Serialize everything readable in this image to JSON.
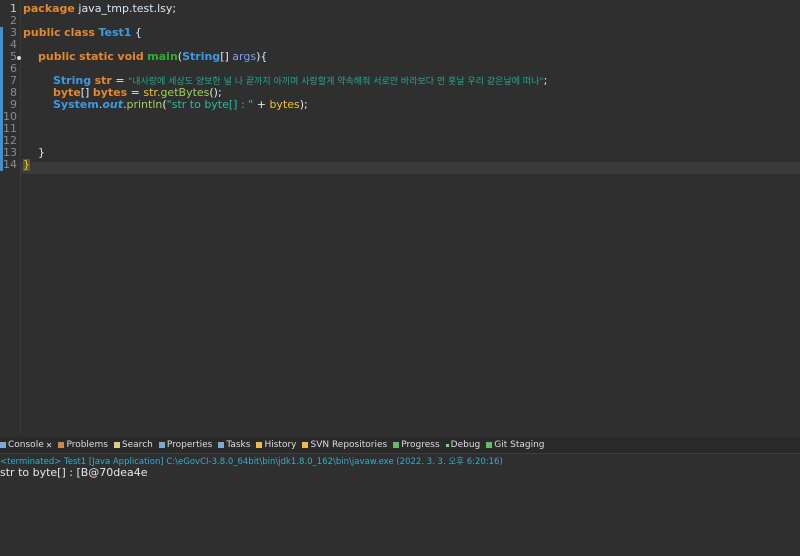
{
  "editor": {
    "lines": [
      "package java_tmp.test.lsy;",
      "",
      "public class Test1 {",
      "",
      "public static void main(String[] args){",
      "",
      "String str = \"내사랑에 세상도 양보한 널 나 끝까지 아끼며 사랑할게 약속해줘 서로만 바라보다 먼 훗날 우리 같은날에 떠나\";",
      "byte[] bytes = str.getBytes();",
      "System.out.println(\"str to byte[] : \" + bytes);",
      "",
      "",
      "",
      "}",
      "}"
    ],
    "line_numbers": [
      "1",
      "2",
      "3",
      "4",
      "5",
      "6",
      "7",
      "8",
      "9",
      "10",
      "11",
      "12",
      "13",
      "14"
    ],
    "tokens": {
      "package": "package",
      "pkg": " java_tmp.test.lsy;",
      "public": "public",
      "class": "class",
      "Test1": "Test1",
      "brace": " {",
      "static": "static",
      "void": "void",
      "main": "main",
      "String": "String",
      "args_pre": "[] ",
      "args": "args",
      "args_post": "){",
      "str": "str",
      "eq": " = ",
      "literal": "\"내사랑에 세상도 양보한 널 나 끝까지 아끼며 사랑할게 약속해줘 서로만 바라보다 먼 훗날 우리 같은날에 떠나\"",
      "semi": ";",
      "byte": "byte",
      "arr": "[] ",
      "bytes": "bytes",
      "getBytes": "getBytes",
      "call": "();",
      "strdot": "str.",
      "System": "System",
      "dot": ".",
      "out": "out",
      "println": "println",
      "plit": "\"str to byte[] : \"",
      "plus": " + ",
      "end": ");",
      "close": "}"
    }
  },
  "console": {
    "tabs": [
      "Console",
      "Problems",
      "Search",
      "Properties",
      "Tasks",
      "History",
      "SVN Repositories",
      "Progress",
      "Debug",
      "Git Staging"
    ],
    "status": "<terminated> Test1 [Java Application] C:\\eGovCI-3.8.0_64bit\\bin\\jdk1.8.0_162\\bin\\javaw.exe (2022. 3. 3. 오후 6:20:16)",
    "output": "str to byte[] : [B@70dea4e"
  }
}
